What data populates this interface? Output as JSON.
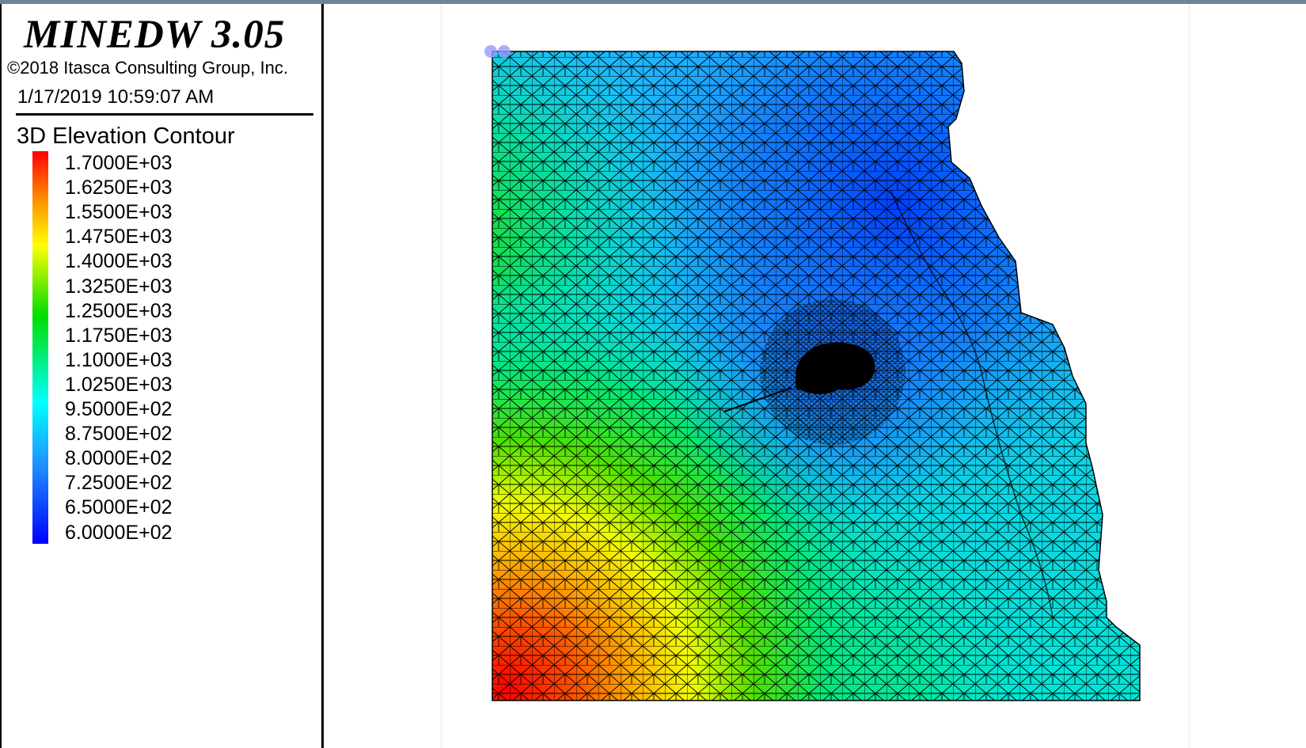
{
  "app": {
    "title": "MINEDW 3.05",
    "copyright": "©2018 Itasca Consulting Group, Inc.",
    "timestamp": "1/17/2019 10:59:07 AM"
  },
  "legend": {
    "title": "3D Elevation Contour",
    "labels": [
      "1.7000E+03",
      "1.6250E+03",
      "1.5500E+03",
      "1.4750E+03",
      "1.4000E+03",
      "1.3250E+03",
      "1.2500E+03",
      "1.1750E+03",
      "1.1000E+03",
      "1.0250E+03",
      "9.5000E+02",
      "8.7500E+02",
      "8.0000E+02",
      "7.2500E+02",
      "6.5000E+02",
      "6.0000E+02"
    ],
    "colors": {
      "max": "#ff0000",
      "high": "#ff8c00",
      "mid_high": "#ffff00",
      "mid": "#00dd00",
      "mid_low": "#00ffff",
      "low": "#1e90ff",
      "min": "#0000ff"
    }
  },
  "plot": {
    "mesh_line_color": "#000000",
    "marker_color": "#9999ff"
  }
}
